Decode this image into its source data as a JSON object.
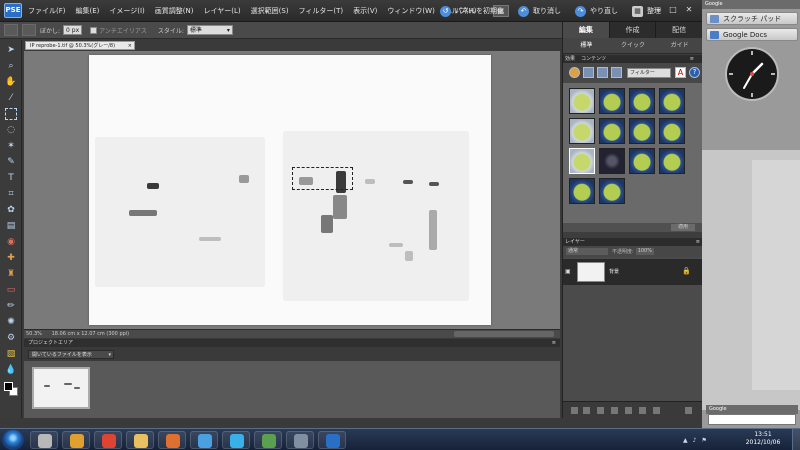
{
  "app": {
    "logo_text": "PSE",
    "menus": [
      "ファイル(F)",
      "編集(E)",
      "イメージ(I)",
      "画質調整(N)",
      "レイヤー(L)",
      "選択範囲(S)",
      "フィルター(T)",
      "表示(V)",
      "ウィンドウ(W)",
      "ヘルプ(H)"
    ],
    "layout_icon": "▦",
    "reset_panels": "パネルを初期化",
    "undo": "取り消し",
    "redo": "やり直し",
    "organizer": "整理",
    "window_controls": [
      "—",
      "□",
      "✕"
    ]
  },
  "options_bar": {
    "feather_label": "ぼかし:",
    "feather_value": "0 px",
    "antialias_label": "アンチエイリアス",
    "style_label": "スタイル:",
    "style_value": "標準"
  },
  "document": {
    "tab_title": "IP reprobe-1.tif @ 50.3%(グレー/8)",
    "tab_close": "×",
    "zoom": "50.3%",
    "status_text": "18.06 cm x 12.07 cm (300 ppi)"
  },
  "project_bin": {
    "title": "プロジェクトエリア",
    "controls": "≡",
    "filter_value": "開いているファイルを表示",
    "arrow": "▾"
  },
  "panel": {
    "tabs": [
      "編集",
      "作成",
      "配信"
    ],
    "subtabs": [
      "標準",
      "クイック",
      "ガイド"
    ],
    "effects_header": [
      "効果",
      "コンテンツ"
    ],
    "effects_dropdown": "フィルター",
    "apply_label": "適用",
    "layers_title": "レイヤー",
    "layers_mode": "通常",
    "opacity_label": "不透明度:",
    "opacity_value": "100%",
    "layer_name": "背景",
    "lock_icon": "🔒",
    "eye_icon": "▣",
    "header_controls": "≡"
  },
  "desktop": {
    "gadget_bar_title": "Google",
    "gadget1": "スクラッチ パッド",
    "gadget2": "Google Docs",
    "search_gadget_title": "Google"
  },
  "taskbar": {
    "time": "13:51",
    "date": "2012/10/06",
    "tray_icons": [
      "▲",
      "♪",
      "⚑"
    ],
    "apps": [
      "Windows Explorer",
      "Media Player",
      "Chrome",
      "Folder",
      "Presentation",
      "iTunes",
      "Skype",
      "Globe",
      "Network",
      "Photoshop Elements"
    ],
    "app_colors": [
      "#b8b8b8",
      "#e0a030",
      "#dd4433",
      "#e8c060",
      "#e07030",
      "#4aa0e0",
      "#3ab0e8",
      "#5aa050",
      "#8090a0",
      "#2a6fc6"
    ]
  }
}
